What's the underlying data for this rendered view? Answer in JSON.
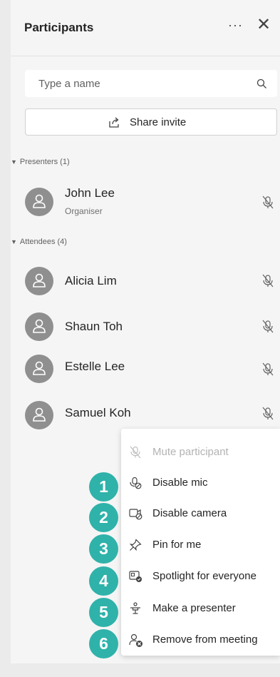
{
  "panel": {
    "title": "Participants",
    "more_label": "···",
    "close_label": "✕"
  },
  "search": {
    "placeholder": "Type a name"
  },
  "share": {
    "label": "Share invite"
  },
  "presenters": {
    "label": "Presenters (1)",
    "people": [
      {
        "name": "John Lee",
        "role": "Organiser"
      }
    ]
  },
  "attendees": {
    "label": "Attendees (4)",
    "people": [
      {
        "name": "Alicia Lim"
      },
      {
        "name": "Shaun Toh"
      },
      {
        "name": "Estelle Lee"
      },
      {
        "name": "Samuel Koh"
      }
    ]
  },
  "menu": {
    "items": [
      {
        "label": "Mute participant",
        "disabled": true,
        "icon": "mic-off-icon"
      },
      {
        "label": "Disable mic",
        "icon": "mic-disable-icon"
      },
      {
        "label": "Disable camera",
        "icon": "camera-off-icon"
      },
      {
        "label": "Pin for me",
        "icon": "pin-icon"
      },
      {
        "label": "Spotlight for everyone",
        "icon": "spotlight-icon"
      },
      {
        "label": "Make a presenter",
        "icon": "presenter-icon"
      },
      {
        "label": "Remove from meeting",
        "icon": "remove-person-icon"
      }
    ]
  },
  "badges": [
    "1",
    "2",
    "3",
    "4",
    "5",
    "6"
  ],
  "colors": {
    "badge": "#2fb2aa",
    "panel": "#f5f5f5"
  }
}
